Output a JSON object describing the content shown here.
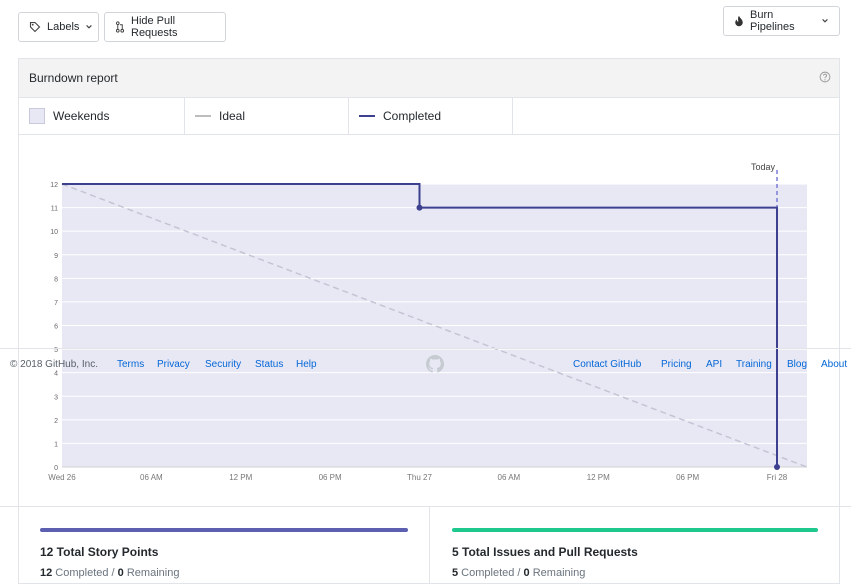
{
  "toolbar": {
    "labels_button": "Labels",
    "hide_pr_button": "Hide Pull Requests",
    "burn_pipelines_button": "Burn Pipelines"
  },
  "panel": {
    "title": "Burndown report",
    "help_icon": "question-circle-icon"
  },
  "legend": {
    "weekends": "Weekends",
    "ideal": "Ideal",
    "completed": "Completed"
  },
  "colors": {
    "weekend_fill": "#e8e8f5",
    "completed_line": "#3d3f8f",
    "ideal_line": "#c4c4d4",
    "today_line": "#7b7bd6",
    "story_points_bar": "#5d5fb0",
    "issues_bar": "#1fc98e",
    "link": "#0366d6"
  },
  "chart_data": {
    "type": "line",
    "title": "",
    "x_ticks": [
      "Wed 26",
      "06 AM",
      "12 PM",
      "06 PM",
      "Thu 27",
      "06 AM",
      "12 PM",
      "06 PM",
      "Fri 28"
    ],
    "y_ticks": [
      0,
      1,
      2,
      3,
      4,
      5,
      6,
      7,
      8,
      9,
      10,
      11,
      12
    ],
    "ylim": [
      0,
      12
    ],
    "xlim_hours": [
      0,
      48
    ],
    "today_label": "Today",
    "today_hour": 48,
    "series": [
      {
        "name": "Completed",
        "style": "step",
        "points": [
          {
            "hour": 0,
            "value": 12
          },
          {
            "hour": 24,
            "value": 11
          },
          {
            "hour": 48,
            "value": 0
          }
        ]
      },
      {
        "name": "Ideal",
        "style": "dashed",
        "points": [
          {
            "hour": 0,
            "value": 12
          },
          {
            "hour": 50,
            "value": 0
          }
        ]
      }
    ]
  },
  "footer": {
    "copyright": "© 2018 GitHub, Inc.",
    "left_links": [
      "Terms",
      "Privacy",
      "Security",
      "Status",
      "Help"
    ],
    "right_links": [
      "Contact GitHub",
      "Pricing",
      "API",
      "Training",
      "Blog",
      "About"
    ],
    "logo_icon": "github-octocat-icon"
  },
  "stats": {
    "story_points": {
      "title": "12 Total Story Points",
      "completed": "12",
      "completed_label": " Completed / ",
      "remaining": "0",
      "remaining_label": " Remaining",
      "progress": 1.0
    },
    "issues": {
      "title": "5 Total Issues and Pull Requests",
      "completed": "5",
      "completed_label": " Completed / ",
      "remaining": "0",
      "remaining_label": " Remaining",
      "progress": 1.0
    }
  }
}
